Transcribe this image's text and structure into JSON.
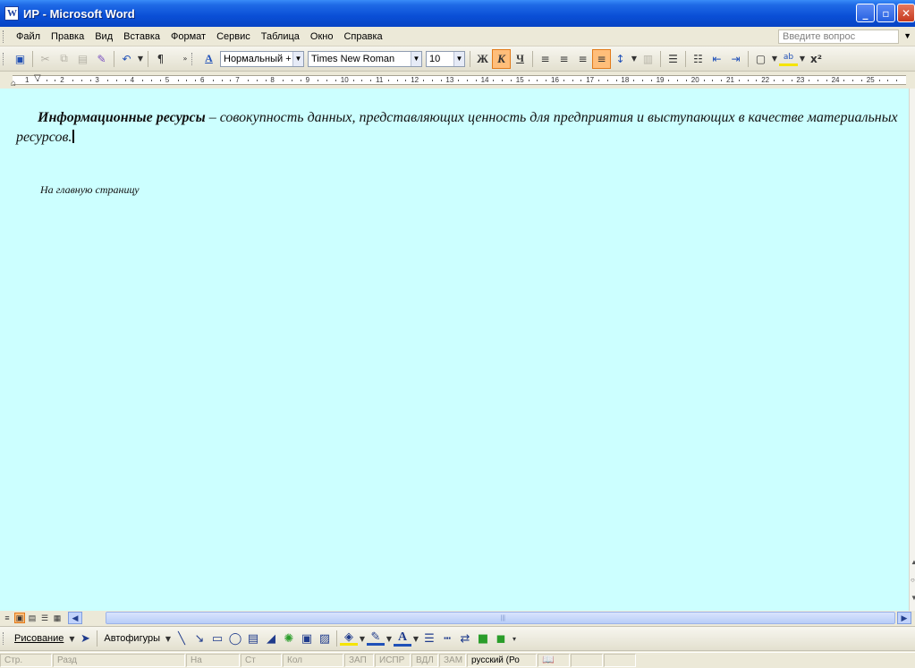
{
  "window": {
    "title": "ИР - Microsoft Word",
    "app_icon_letter": "W",
    "controls": {
      "minimize": "_",
      "maximize": "▫",
      "close": "✕"
    }
  },
  "menu": {
    "items": [
      {
        "label": "Файл"
      },
      {
        "label": "Правка"
      },
      {
        "label": "Вид"
      },
      {
        "label": "Вставка"
      },
      {
        "label": "Формат"
      },
      {
        "label": "Сервис"
      },
      {
        "label": "Таблица"
      },
      {
        "label": "Окно"
      },
      {
        "label": "Справка"
      }
    ],
    "ask_placeholder": "Введите вопрос"
  },
  "toolbar": {
    "style_value": "Нормальный + к",
    "font_value": "Times New Roman",
    "size_value": "10",
    "bold": "Ж",
    "italic": "К",
    "underline": "Ч",
    "pilcrow": "¶",
    "superscript": "x²",
    "highlight_label": "ab"
  },
  "ruler": {
    "numbers": [
      "1",
      "2",
      "3",
      "4",
      "5",
      "6",
      "7",
      "8",
      "9",
      "10",
      "11",
      "12",
      "13",
      "14",
      "15",
      "16",
      "17",
      "18",
      "19",
      "20",
      "21",
      "22",
      "23",
      "24",
      "25"
    ]
  },
  "document": {
    "term": "Информационные ресурсы",
    "definition": " – совокупность данных, представляющих ценность для предприятия и выступающих в качестве материальных ресурсов.",
    "link": "На главную страницу"
  },
  "drawing": {
    "draw_label": "Рисование",
    "autoshapes_label": "Автофигуры"
  },
  "status": {
    "page": "Стр.",
    "section": "Разд",
    "at": "На",
    "line": "Ст",
    "col": "Кол",
    "rec": "ЗАП",
    "trk": "ИСПР",
    "ext": "ВДЛ",
    "ovr": "ЗАМ",
    "language": "русский (Ро"
  }
}
